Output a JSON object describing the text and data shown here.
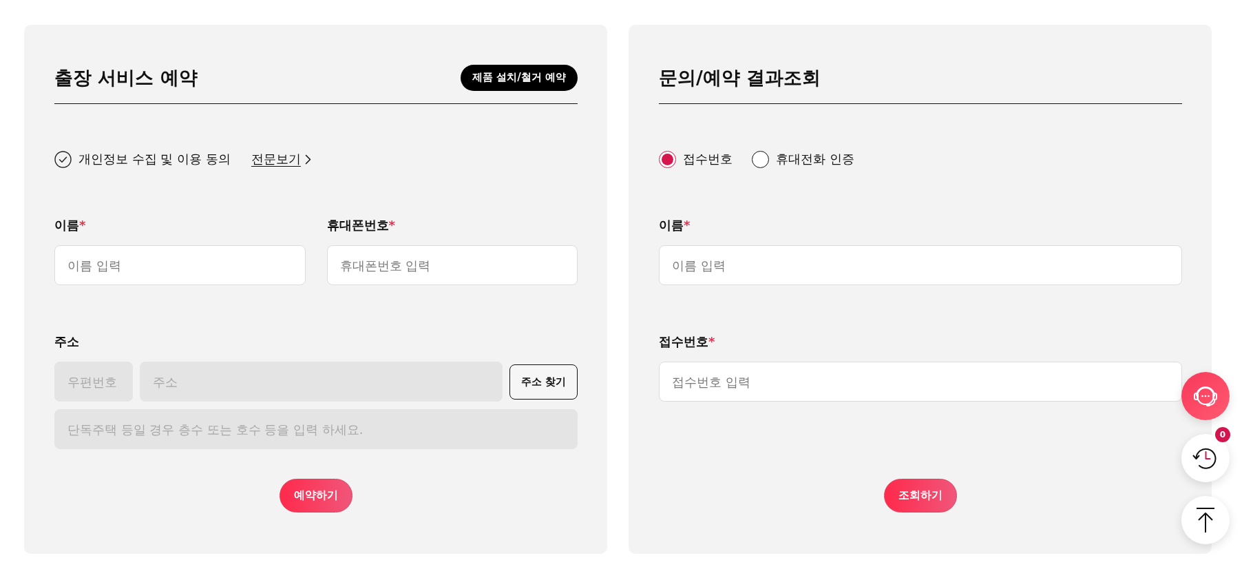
{
  "booking_form": {
    "title": "출장 서비스 예약",
    "badge_button": "제품 설치/철거 예약",
    "consent": {
      "label": "개인정보 수집 및 이용 동의",
      "checked": false,
      "link": "전문보기"
    },
    "fields": [
      {
        "label": "이름",
        "required_mark": "*",
        "placeholder": "이름 입력"
      },
      {
        "label": "휴대폰번호",
        "required_mark": "*",
        "placeholder": "휴대폰번호 입력"
      }
    ],
    "address": {
      "label": "주소",
      "zip": {
        "placeholder": "우편번호",
        "disabled": true
      },
      "street": {
        "placeholder": "주소",
        "disabled": true
      },
      "search_button": "주소 찾기",
      "detail": {
        "placeholder": "단독주택 등일 경우 층수 또는 호수 등을 입력 하세요.",
        "disabled": true
      }
    },
    "submit_button": "예약하기"
  },
  "lookup_form": {
    "title": "문의/예약 결과조회",
    "methods": [
      {
        "label": "접수번호",
        "selected": true
      },
      {
        "label": "휴대전화 인증",
        "selected": false
      }
    ],
    "fields": [
      {
        "label": "이름",
        "required_mark": "*",
        "placeholder": "이름 입력"
      },
      {
        "label": "접수번호",
        "required_mark": "*",
        "placeholder": "접수번호 입력"
      }
    ],
    "submit_button": "조회하기"
  },
  "floating_buttons": [
    {
      "kind": "chat"
    },
    {
      "kind": "history",
      "badge": "0"
    },
    {
      "kind": "top"
    }
  ]
}
